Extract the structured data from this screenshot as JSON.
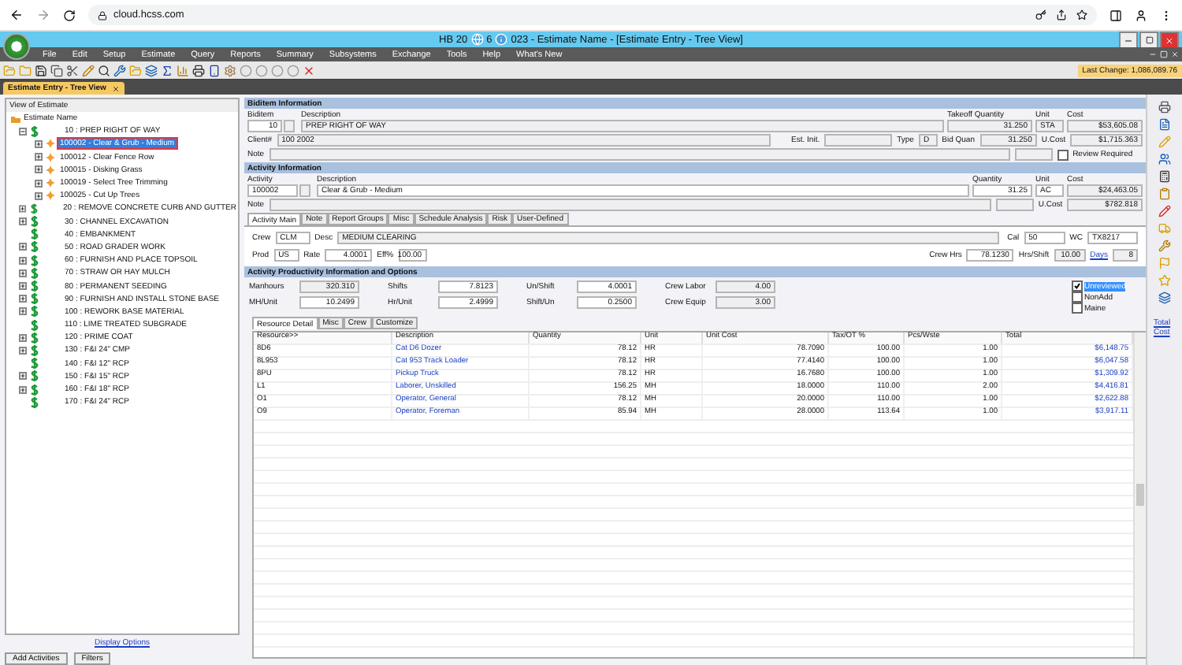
{
  "browser": {
    "url": "cloud.hcss.com"
  },
  "window": {
    "title_parts": [
      "HB 20",
      "6",
      "023 - Estimate Name  - [Estimate Entry - Tree View]"
    ]
  },
  "menu": [
    "File",
    "Edit",
    "Setup",
    "Estimate",
    "Query",
    "Reports",
    "Summary",
    "Subsystems",
    "Exchange",
    "Tools",
    "Help",
    "What's New"
  ],
  "last_change": "Last Change: 1,086,089.76",
  "doc_tab": {
    "label": "Estimate Entry - Tree View"
  },
  "tree": {
    "header": "View of Estimate",
    "root": "Estimate Name",
    "items": [
      {
        "label": "10 : PREP RIGHT OF WAY",
        "expandable": true,
        "expanded": true,
        "children": [
          {
            "label": "100002 - Clear & Grub - Medium",
            "selected": true
          },
          {
            "label": "100012 - Clear Fence Row",
            "selected": false
          },
          {
            "label": "100015 - Disking Grass",
            "selected": false
          },
          {
            "label": "100019 - Select Tree Trimming",
            "selected": false
          },
          {
            "label": "100025 - Cut Up Trees",
            "selected": false
          }
        ]
      },
      {
        "label": "20 : REMOVE CONCRETE CURB AND GUTTER",
        "expandable": true
      },
      {
        "label": "30 : CHANNEL EXCAVATION",
        "expandable": true
      },
      {
        "label": "40 : EMBANKMENT"
      },
      {
        "label": "50 : ROAD GRADER WORK",
        "expandable": true
      },
      {
        "label": "60 : FURNISH AND PLACE TOPSOIL",
        "expandable": true
      },
      {
        "label": "70 : STRAW OR HAY MULCH",
        "expandable": true
      },
      {
        "label": "80 : PERMANENT SEEDING",
        "expandable": true
      },
      {
        "label": "90 : FURNISH AND INSTALL STONE BASE",
        "expandable": true
      },
      {
        "label": "100 : REWORK BASE MATERIAL",
        "expandable": true
      },
      {
        "label": "110 : LIME TREATED SUBGRADE"
      },
      {
        "label": "120 : PRIME COAT",
        "expandable": true
      },
      {
        "label": "130 : F&I 24\" CMP",
        "expandable": true
      },
      {
        "label": "140 : F&I 12\" RCP"
      },
      {
        "label": "150 : F&I 15\" RCP",
        "expandable": true
      },
      {
        "label": "160 : F&I 18\" RCP",
        "expandable": true
      },
      {
        "label": "170 : F&I 24\" RCP"
      }
    ]
  },
  "tree_footer": {
    "link": "Display Options",
    "buttons": [
      "Add Activities",
      "Filters"
    ]
  },
  "biditem": {
    "header": "Biditem Information",
    "biditem_label": "Biditem",
    "biditem": "10",
    "description_label": "Description",
    "description": "PREP RIGHT OF WAY",
    "takeoff_label": "Takeoff Quantity",
    "takeoff": "31.250",
    "unit_label": "Unit",
    "unit": "STA",
    "cost_label": "Cost",
    "cost": "$53,605.08",
    "client_label": "Client#",
    "client": "100 2002",
    "estinit_label": "Est. Init.",
    "type_label": "Type",
    "type": "D",
    "bidquan_label": "Bid Quan",
    "bidquan": "31.250",
    "ucost_label": "U.Cost",
    "ucost": "$1,715.363",
    "note_label": "Note",
    "review_label": "Review Required",
    "review_checked": false
  },
  "activity": {
    "header": "Activity Information",
    "activity_label": "Activity",
    "activity": "100002",
    "description_label": "Description",
    "description": "Clear & Grub - Medium",
    "quantity_label": "Quantity",
    "quantity": "31.25",
    "unit_label": "Unit",
    "unit": "AC",
    "cost_label": "Cost",
    "cost": "$24,463.05",
    "note_label": "Note",
    "ucost_label": "U.Cost",
    "ucost": "$782.818"
  },
  "activity_tabs": [
    {
      "label": "Activity Main",
      "selected": true
    },
    {
      "label": "Note",
      "selected": false
    },
    {
      "label": "Report Groups",
      "selected": false
    },
    {
      "label": "Misc",
      "selected": false
    },
    {
      "label": "Schedule Analysis",
      "selected": false
    },
    {
      "label": "Risk",
      "selected": false
    },
    {
      "label": "User-Defined",
      "selected": false
    }
  ],
  "activity_main": {
    "crew_label": "Crew",
    "crew": "CLM",
    "desc_label": "Desc",
    "desc": "MEDIUM CLEARING",
    "cal_label": "Cal",
    "cal": "50",
    "wc_label": "WC",
    "wc": "TX8217",
    "prod_label": "Prod",
    "prod": "US",
    "rate_label": "Rate",
    "rate": "4.0001",
    "eff_label": "Eff%",
    "eff": "100.00",
    "crewhrs_label": "Crew Hrs",
    "crewhrs": "78.1230",
    "hrsshift_label": "Hrs/Shift",
    "hrsshift": "10.00",
    "days_link": "Days",
    "days": "8"
  },
  "productivity": {
    "header": "Activity Productivity Information and Options",
    "rows": [
      [
        {
          "label": "Manhours",
          "value": "320.310",
          "readonly": true
        },
        {
          "label": "Shifts",
          "value": "7.8123",
          "readonly": false
        },
        {
          "label": "Un/Shift",
          "value": "4.0001",
          "readonly": false
        },
        {
          "label": "Crew Labor",
          "value": "4.00",
          "readonly": true
        }
      ],
      [
        {
          "label": "MH/Unit",
          "value": "10.2499",
          "readonly": false
        },
        {
          "label": "Hr/Unit",
          "value": "2.4999",
          "readonly": false
        },
        {
          "label": "Shift/Un",
          "value": "0.2500",
          "readonly": false
        },
        {
          "label": "Crew Equip",
          "value": "3.00",
          "readonly": true
        }
      ]
    ],
    "options": [
      {
        "label": "Unreviewed",
        "checked": true,
        "selected": true
      },
      {
        "label": "NonAdd",
        "checked": false,
        "selected": false
      },
      {
        "label": "Maine",
        "checked": false,
        "selected": false
      }
    ]
  },
  "resource_tabs": [
    {
      "label": "Resource Detail",
      "selected": true
    },
    {
      "label": "Misc",
      "selected": false
    },
    {
      "label": "Crew",
      "selected": false
    },
    {
      "label": "Customize",
      "selected": false
    }
  ],
  "table": {
    "columns": [
      "Resource>>",
      "Description",
      "Quantity",
      "Unit",
      "Unit Cost",
      "Tax/OT %",
      "Pcs/Wste",
      "Total"
    ],
    "rows": [
      [
        "8D6",
        "Cat D6 Dozer",
        "78.12",
        "HR",
        "78.7090",
        "100.00",
        "1.00",
        "$6,148.75"
      ],
      [
        "8L953",
        "Cat 953 Track Loader",
        "78.12",
        "HR",
        "77.4140",
        "100.00",
        "1.00",
        "$6,047.58"
      ],
      [
        "8PU",
        "Pickup Truck",
        "78.12",
        "HR",
        "16.7680",
        "100.00",
        "1.00",
        "$1,309.92"
      ],
      [
        "L1",
        "Laborer, Unskilled",
        "156.25",
        "MH",
        "18.0000",
        "110.00",
        "2.00",
        "$4,416.81"
      ],
      [
        "O1",
        "Operator, General",
        "78.12",
        "MH",
        "20.0000",
        "110.00",
        "1.00",
        "$2,622.88"
      ],
      [
        "O9",
        "Operator, Foreman",
        "85.94",
        "MH",
        "28.0000",
        "113.64",
        "1.00",
        "$3,917.11"
      ]
    ]
  },
  "side_link": "Total Cost"
}
